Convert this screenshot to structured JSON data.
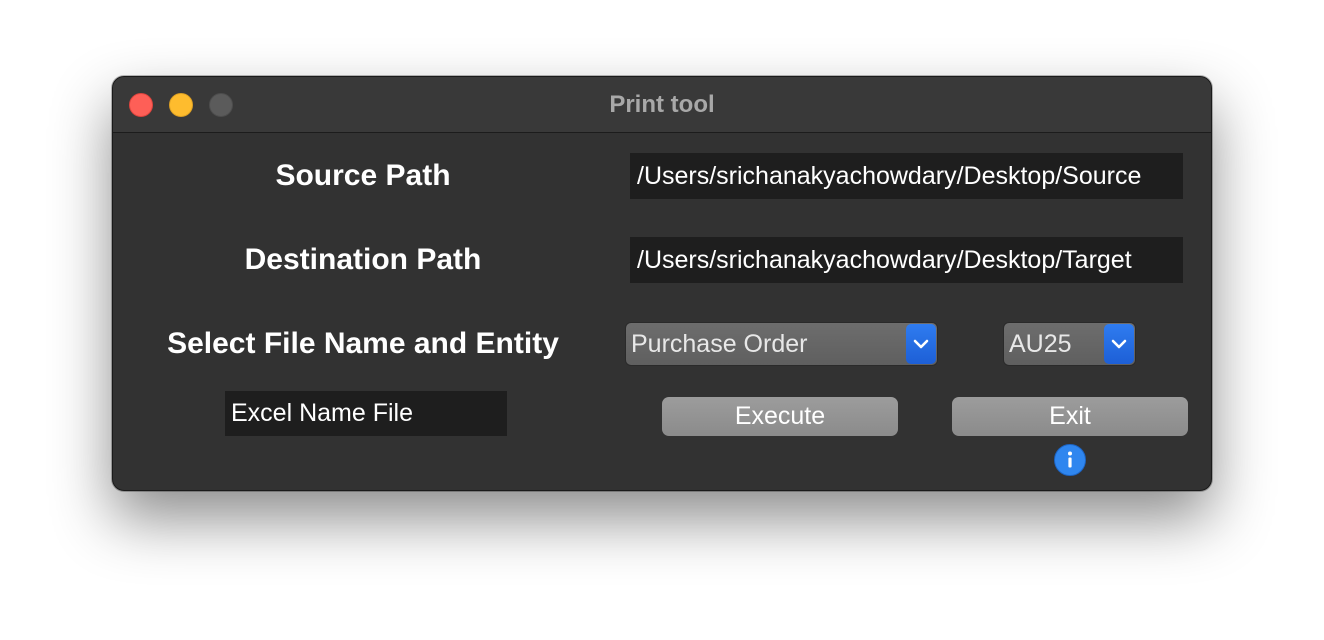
{
  "window": {
    "title": "Print tool"
  },
  "form": {
    "source_label": "Source Path",
    "source_value": "/Users/srichanakyachowdary/Desktop/Source",
    "destination_label": "Destination Path",
    "destination_value": "/Users/srichanakyachowdary/Desktop/Target",
    "select_label": "Select File Name and Entity",
    "file_name_selected": "Purchase Order",
    "entity_selected": "AU25",
    "excel_name_value": "Excel Name File"
  },
  "buttons": {
    "execute_label": "Execute",
    "exit_label": "Exit"
  },
  "icons": {
    "close": "close-icon",
    "minimize": "minimize-icon",
    "zoom": "zoom-icon",
    "dropdown": "chevron-down-icon",
    "info": "info-icon"
  },
  "colors": {
    "window_bg": "#323232",
    "field_bg": "#1e1e1e",
    "accent": "#1d5fd6",
    "close": "#fe5f57",
    "minimize": "#febc2e",
    "button_bg": "#949494"
  }
}
